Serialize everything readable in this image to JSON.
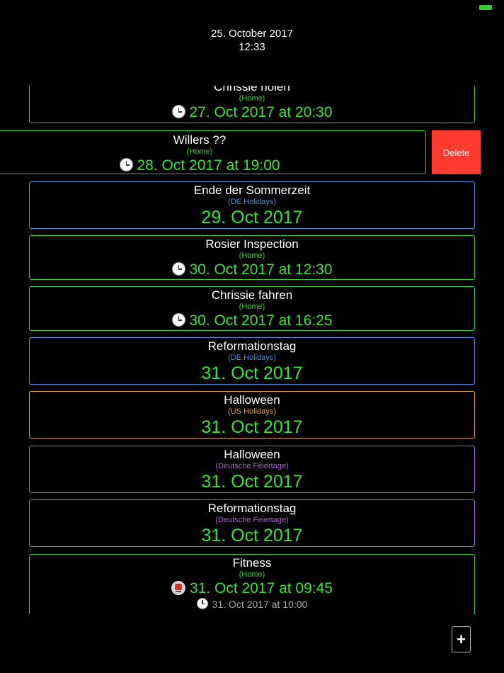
{
  "header": {
    "date": "25. October 2017",
    "time": "12:33"
  },
  "colors": {
    "home": "#2fcf2f",
    "de_holidays": "#4a8fd8",
    "us_holidays": "#e6a13a",
    "deutsche_feiertage": "#b05fd6",
    "date_text": "#33e633",
    "delete": "#ff3b30"
  },
  "events": [
    {
      "title": "Chrissie holen",
      "calendar": "(Home)",
      "when": "27. Oct 2017 at 20:30",
      "icon": "clock-icon"
    },
    {
      "title": "Willers ??",
      "calendar": "(Home)",
      "when": "28. Oct 2017 at 19:00",
      "icon": "clock-icon",
      "swiped": true
    },
    {
      "title": "Ende der Sommerzeit",
      "calendar": "(DE Holidays)",
      "when": "29. Oct 2017"
    },
    {
      "title": "Rosier Inspection",
      "calendar": "(Home)",
      "when": "30. Oct 2017 at 12:30",
      "icon": "clock-icon"
    },
    {
      "title": "Chrissie fahren",
      "calendar": "(Home)",
      "when": "30. Oct 2017 at 16:25",
      "icon": "clock-icon"
    },
    {
      "title": "Reformationstag",
      "calendar": "(DE Holidays)",
      "when": "31. Oct 2017"
    },
    {
      "title": "Halloween",
      "calendar": "(US Holidays)",
      "when": "31. Oct 2017"
    },
    {
      "title": "Halloween",
      "calendar": "(Deutsche Feiertage)",
      "when": "31. Oct 2017"
    },
    {
      "title": "Reformationstag",
      "calendar": "(Deutsche Feiertage)",
      "when": "31. Oct 2017"
    },
    {
      "title": "Fitness",
      "calendar": "(Home)",
      "when": "31. Oct 2017 at 09:45",
      "icon": "train-icon",
      "when2": "31. Oct 2017 at 10:00",
      "icon2": "clock-icon"
    }
  ],
  "actions": {
    "delete_label": "Delete",
    "add_label": "+"
  }
}
